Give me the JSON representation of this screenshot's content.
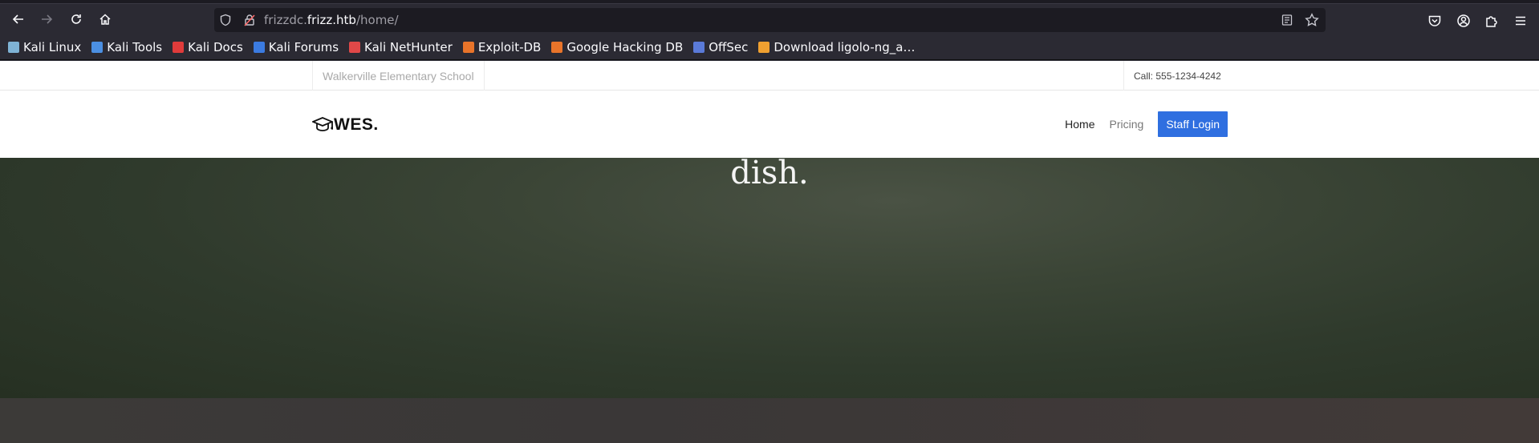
{
  "browser": {
    "url_prefix": "frizzdc.",
    "url_host": "frizz.htb",
    "url_path": "/home/"
  },
  "bookmarks": [
    {
      "label": "Kali Linux",
      "icon": "kali-dragon-icon",
      "color": "#7fb3d5"
    },
    {
      "label": "Kali Tools",
      "icon": "kali-tools-icon",
      "color": "#4b8fe2"
    },
    {
      "label": "Kali Docs",
      "icon": "kali-docs-icon",
      "color": "#e03b3b"
    },
    {
      "label": "Kali Forums",
      "icon": "kali-forums-icon",
      "color": "#3b7be0"
    },
    {
      "label": "Kali NetHunter",
      "icon": "nethunter-icon",
      "color": "#e04848"
    },
    {
      "label": "Exploit-DB",
      "icon": "exploitdb-icon",
      "color": "#e8742a"
    },
    {
      "label": "Google Hacking DB",
      "icon": "ghdb-icon",
      "color": "#e8742a"
    },
    {
      "label": "OffSec",
      "icon": "offsec-icon",
      "color": "#5a7ad8"
    },
    {
      "label": "Download ligolo-ng_a…",
      "icon": "ligolo-icon",
      "color": "#f0a030"
    }
  ],
  "site": {
    "school_name": "Walkerville Elementary School",
    "phone": "Call: 555-1234-4242",
    "brand": "WES.",
    "nav": [
      {
        "label": "Home"
      },
      {
        "label": "Pricing"
      }
    ],
    "login_label": "Staff Login",
    "hero_text": "dish."
  },
  "colors": {
    "accent": "#2f6fe0",
    "hero": "#3b4536"
  }
}
